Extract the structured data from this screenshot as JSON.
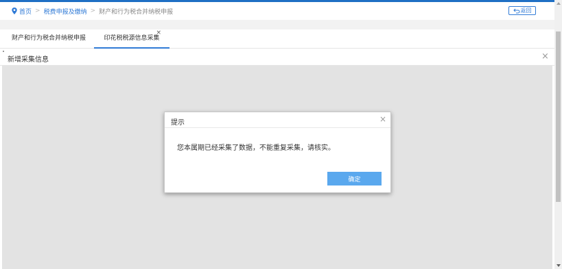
{
  "breadcrumb": {
    "home": "首页",
    "level1": "税费申报及缴纳",
    "current": "财产和行为税合并纳税申报",
    "separator": ">"
  },
  "back_button": {
    "label": "返回"
  },
  "tabs": [
    {
      "label": "财产和行为税合并纳税申报",
      "active": false
    },
    {
      "label": "印花税税源信息采集",
      "active": true,
      "close": "×"
    }
  ],
  "panel": {
    "title": "新增采集信息",
    "close": "×"
  },
  "dialog": {
    "title": "提示",
    "close": "×",
    "message": "您本属期已经采集了数据，不能重复采集，请核实。",
    "ok_label": "确定"
  },
  "colors": {
    "accent": "#2f7ad6",
    "button": "#5aa8ee",
    "overlay": "#e3e3e3"
  },
  "icons": {
    "home": "location-pin-icon",
    "back": "return-arrow-icon"
  }
}
